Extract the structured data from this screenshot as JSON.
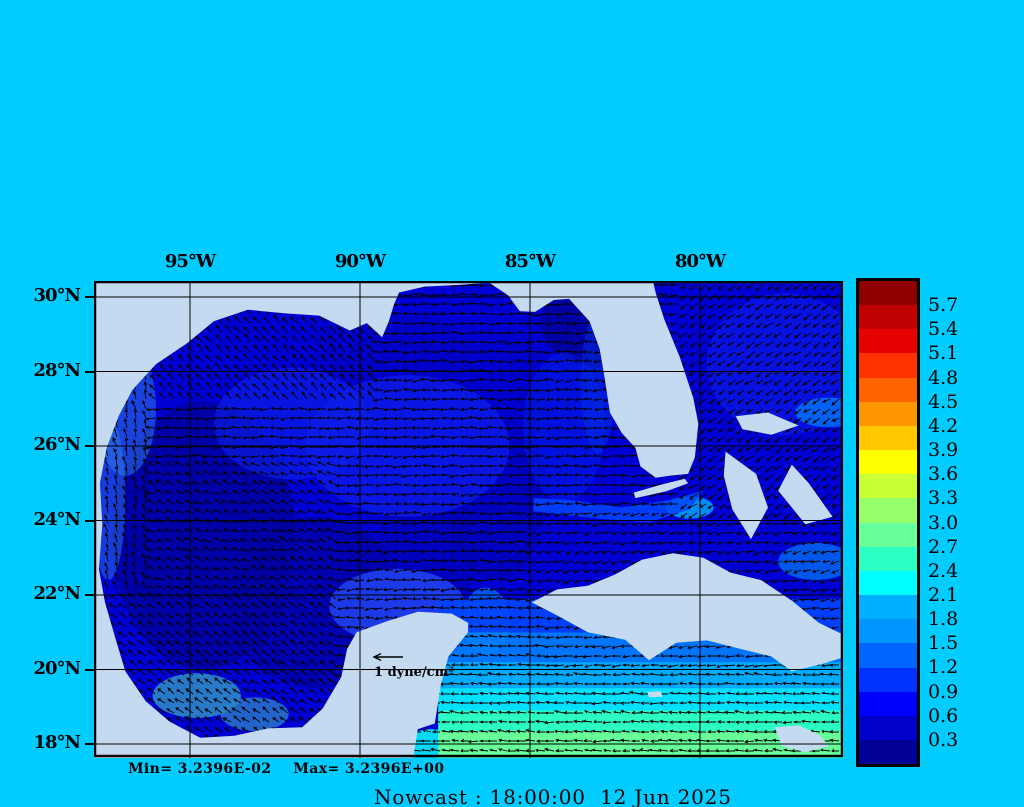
{
  "figure": {
    "background_color": "#00CCFF"
  },
  "title": {
    "text": "Nowcast : 18:00:00  12 Jun 2025"
  },
  "stats": {
    "min_text": "Min= 3.2396E-02",
    "max_text": "Max= 3.2396E+00"
  },
  "map": {
    "land_color": "#C4DAF0",
    "water_color": "#0000D5",
    "grid_color": "#000000",
    "frame_color": "#000000",
    "arrow_color": "#000000",
    "x_ticks": [
      {
        "label": "95°W",
        "lon_w": 95
      },
      {
        "label": "90°W",
        "lon_w": 90
      },
      {
        "label": "85°W",
        "lon_w": 85
      },
      {
        "label": "80°W",
        "lon_w": 80
      }
    ],
    "y_ticks": [
      {
        "label": "30°N",
        "lat": 30
      },
      {
        "label": "28°N",
        "lat": 28
      },
      {
        "label": "26°N",
        "lat": 26
      },
      {
        "label": "24°N",
        "lat": 24
      },
      {
        "label": "22°N",
        "lat": 22
      },
      {
        "label": "20°N",
        "lat": 20
      },
      {
        "label": "18°N",
        "lat": 18
      }
    ],
    "vector_key": {
      "label": "1 dyne/cm²"
    }
  },
  "colorbar": {
    "tick_labels_top_to_bottom": [
      "5.7",
      "5.4",
      "5.1",
      "4.8",
      "4.5",
      "4.2",
      "3.9",
      "3.6",
      "3.3",
      "3.0",
      "2.7",
      "2.4",
      "2.1",
      "1.8",
      "1.5",
      "1.2",
      "0.9",
      "0.6",
      "0.3"
    ],
    "segment_colors_bottom_to_top": [
      "#000096",
      "#0000C8",
      "#0000FF",
      "#0032FF",
      "#0064FF",
      "#0096FF",
      "#00AFFF",
      "#00FFFF",
      "#2BFFC4",
      "#66FF99",
      "#96FF69",
      "#C8FF37",
      "#FFFF00",
      "#FFC800",
      "#FF9600",
      "#FF6400",
      "#FF3200",
      "#E60000",
      "#BE0000",
      "#900000"
    ]
  },
  "chart_data": {
    "type": "heatmap",
    "title": "Nowcast : 18:00:00  12 Jun 2025",
    "units": "dyne/cm²",
    "x_tick_labels": [
      "95°W",
      "90°W",
      "85°W",
      "80°W"
    ],
    "y_tick_labels": [
      "30°N",
      "28°N",
      "26°N",
      "24°N",
      "22°N",
      "20°N",
      "18°N"
    ],
    "colorbar_levels": [
      0.3,
      0.6,
      0.9,
      1.2,
      1.5,
      1.8,
      2.1,
      2.4,
      2.7,
      3.0,
      3.3,
      3.6,
      3.9,
      4.2,
      4.5,
      4.8,
      5.1,
      5.4,
      5.7
    ],
    "colorbar_colors_bottom_to_top": [
      "#000096",
      "#0000C8",
      "#0000FF",
      "#0032FF",
      "#0064FF",
      "#0096FF",
      "#00AFFF",
      "#00FFFF",
      "#2BFFC4",
      "#66FF99",
      "#96FF69",
      "#C8FF37",
      "#FFFF00",
      "#FFC800",
      "#FF9600",
      "#FF6400",
      "#FF3200",
      "#E60000",
      "#BE0000",
      "#900000"
    ],
    "data_min": "3.2396E-02",
    "data_max": "3.2396E+00",
    "vector_key": "1 dyne/cm²",
    "legend_position": "right",
    "grid": true,
    "description": "Vector-arrow field over shaded magnitude map of the Gulf of Mexico and northwest Caribbean; mostly 0.3–1.2 dyne/cm² (dark blue) in the Gulf, rising to 1.8–3.0 (cyan–green) south of Cuba near 18N"
  }
}
